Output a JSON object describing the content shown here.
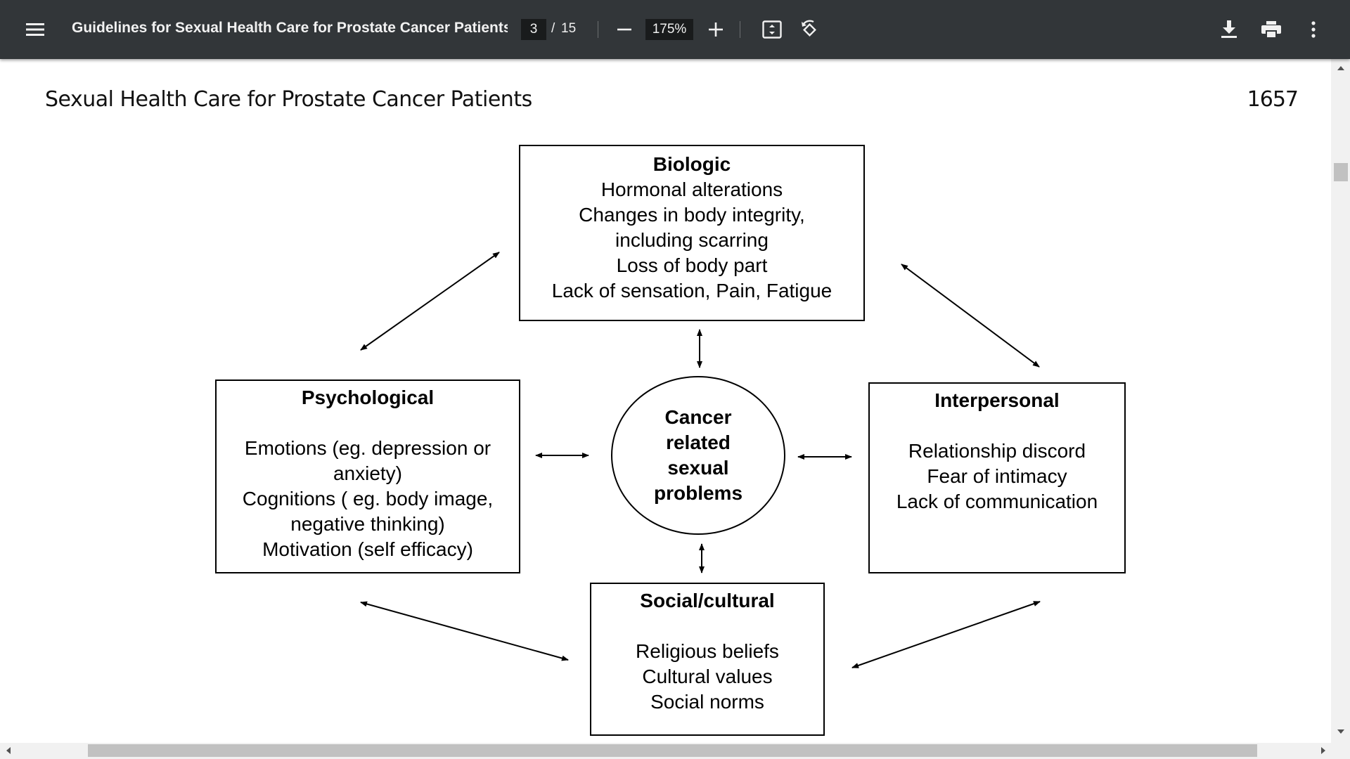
{
  "toolbar": {
    "title": "Guidelines for Sexual Health Care for Prostate Cancer Patients: ...",
    "current_page": "3",
    "page_separator": "/",
    "total_pages": "15",
    "zoom": "175%",
    "icons": [
      "menu-icon",
      "zoom-out-icon",
      "zoom-in-icon",
      "fit-page-icon",
      "rotate-icon",
      "download-icon",
      "print-icon",
      "more-vert-icon"
    ]
  },
  "page": {
    "header_title": "Sexual Health Care for Prostate Cancer Patients",
    "page_number": "1657"
  },
  "diagram": {
    "biologic": {
      "heading": "Biologic",
      "lines": [
        "Hormonal alterations",
        "Changes in body integrity,",
        "including scarring",
        "Loss of body part",
        "Lack of sensation, Pain, Fatigue"
      ]
    },
    "psychological": {
      "heading": "Psychological",
      "lines": [
        "Emotions (eg. depression or",
        "anxiety)",
        "Cognitions ( eg. body image,",
        "negative thinking)",
        "Motivation  (self efficacy)"
      ]
    },
    "interpersonal": {
      "heading": "Interpersonal",
      "lines": [
        "Relationship discord",
        "Fear of intimacy",
        "Lack of communication"
      ]
    },
    "social": {
      "heading": "Social/cultural",
      "lines": [
        "Religious beliefs",
        "Cultural values",
        "Social norms"
      ]
    },
    "center": {
      "lines": [
        "Cancer",
        "related",
        "sexual",
        "problems"
      ]
    }
  }
}
